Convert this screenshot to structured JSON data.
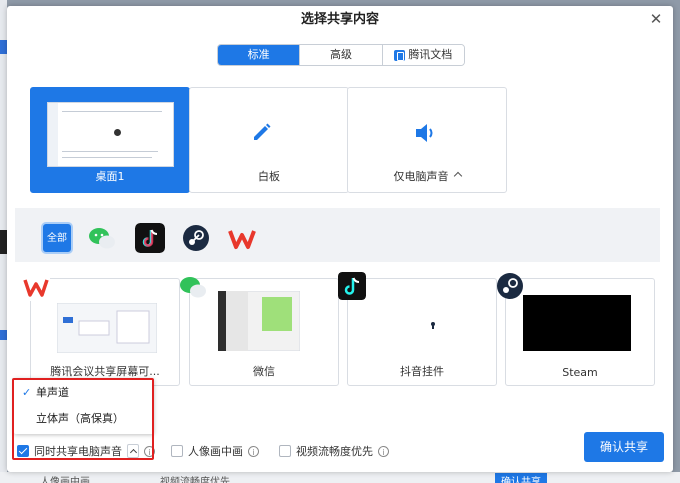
{
  "dialog": {
    "title": "选择共享内容",
    "close_glyph": "✕"
  },
  "tabs": [
    {
      "label": "标准",
      "active": true
    },
    {
      "label": "高级",
      "active": false
    },
    {
      "label": "腾讯文档",
      "active": false,
      "icon": "tencent-docs-icon"
    }
  ],
  "sources": [
    {
      "label": "桌面1",
      "selected": true
    },
    {
      "label": "白板",
      "icon": "pen-icon"
    },
    {
      "label": "仅电脑声音",
      "icon": "speaker-icon"
    }
  ],
  "app_filters": {
    "all_label": "全部",
    "apps": [
      "wechat-icon",
      "douyin-icon",
      "steam-icon",
      "wps-icon"
    ]
  },
  "windows": [
    {
      "label": "腾讯会议共享屏幕可...",
      "icon": "wps-icon"
    },
    {
      "label": "微信",
      "icon": "wechat-icon"
    },
    {
      "label": "抖音挂件",
      "icon": "douyin-icon"
    },
    {
      "label": "Steam",
      "icon": "steam-icon"
    }
  ],
  "audio_menu": {
    "items": [
      {
        "label": "单声道",
        "checked": true
      },
      {
        "label": "立体声（高保真）",
        "checked": false
      }
    ]
  },
  "options": {
    "share_audio": {
      "label": "同时共享电脑声音",
      "checked": true
    },
    "pip": {
      "label": "人像画中画",
      "checked": false
    },
    "video_priority": {
      "label": "视频流畅度优先",
      "checked": false
    }
  },
  "confirm_label": "确认共享",
  "background": {
    "bottom_texts": [
      "人像画中画",
      "视频流畅度优先",
      "确认共享"
    ]
  },
  "colors": {
    "accent": "#1e78e6",
    "highlight_border": "#e02020"
  }
}
